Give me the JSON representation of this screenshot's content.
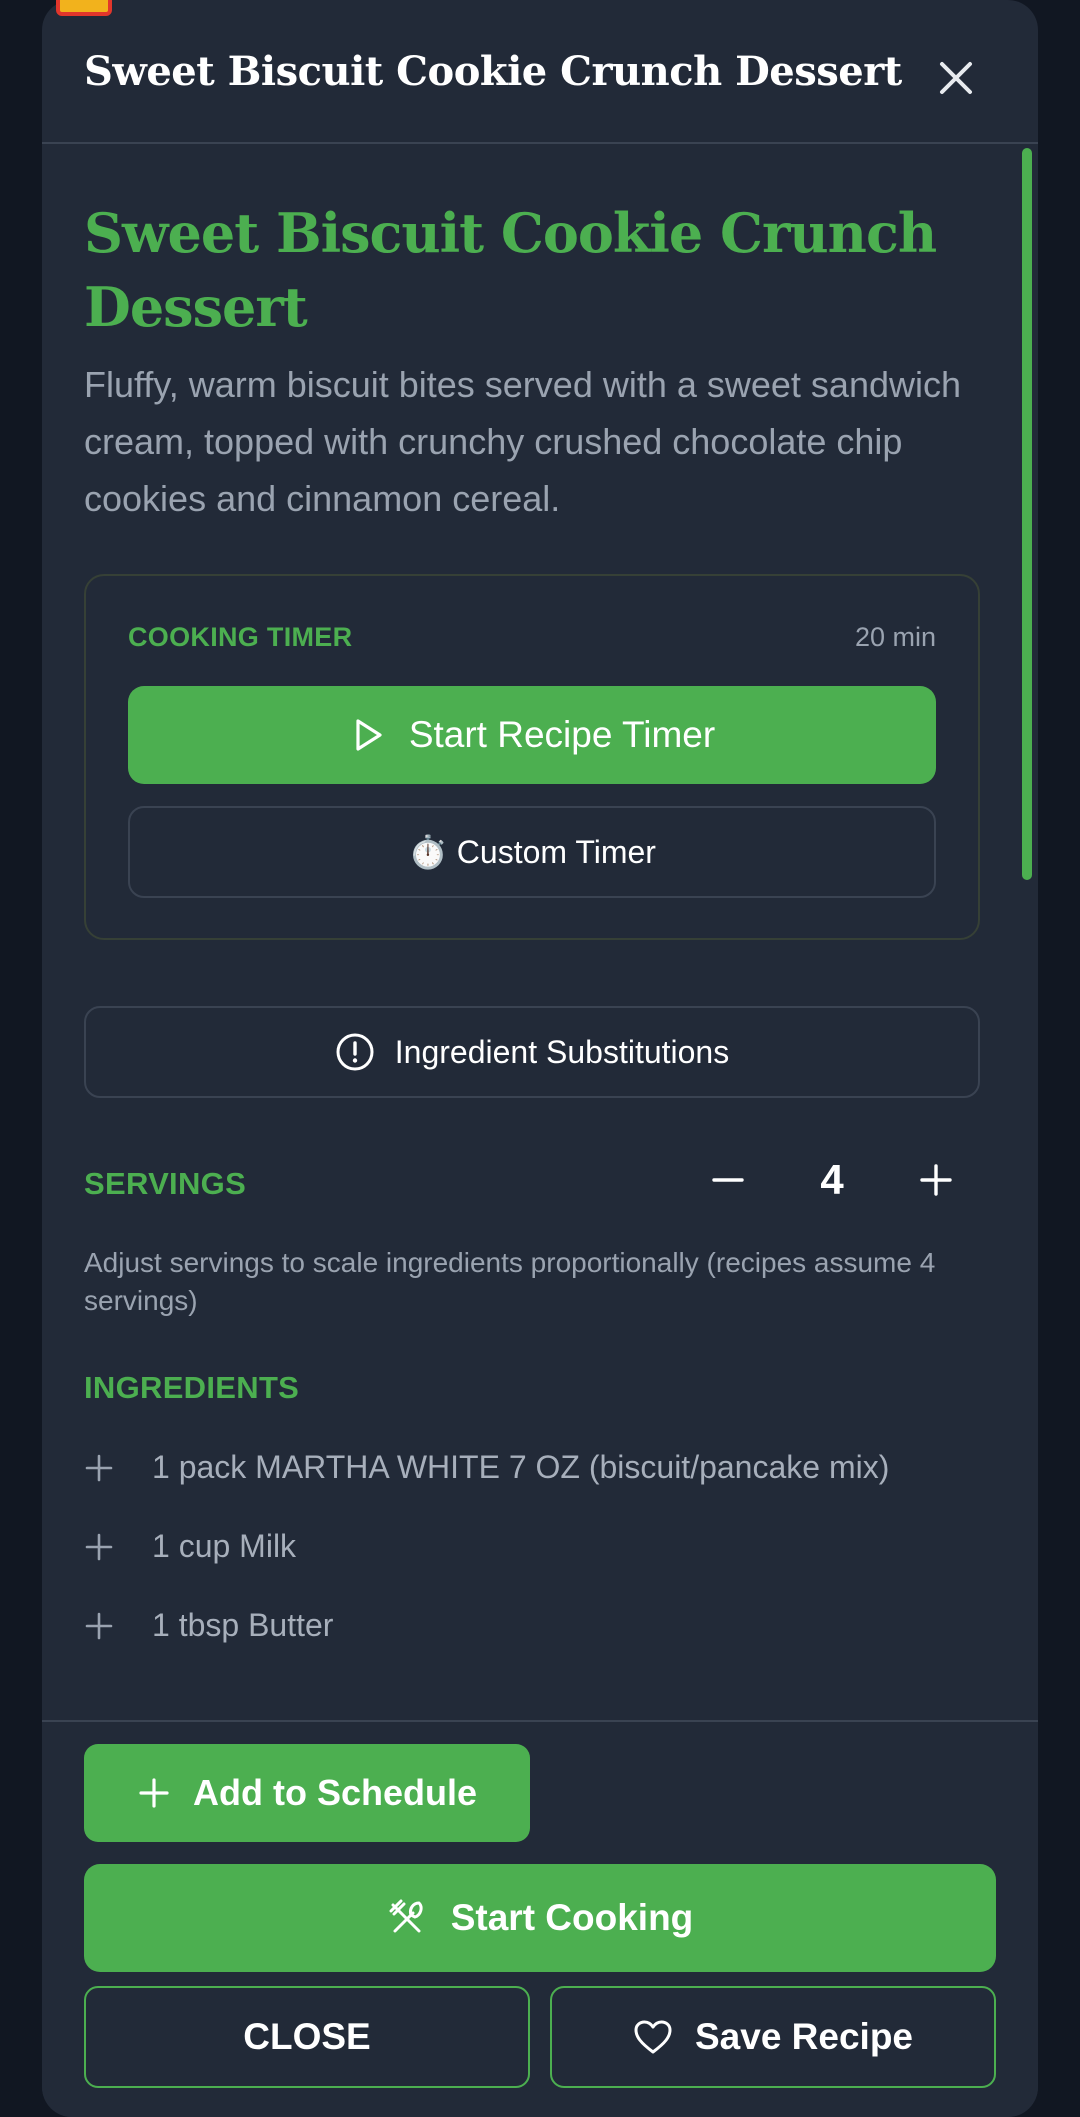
{
  "header": {
    "title": "Sweet Biscuit Cookie Crunch Dessert",
    "close_icon": "close-icon"
  },
  "recipe": {
    "title": "Sweet Biscuit Cookie Crunch Dessert",
    "description": "Fluffy, warm biscuit bites served with a sweet sandwich cream, topped with crunchy crushed chocolate chip cookies and cinnamon cereal."
  },
  "timer": {
    "label": "COOKING TIMER",
    "duration": "20 min",
    "start_label": "Start Recipe Timer",
    "custom_label": "⏱️ Custom Timer"
  },
  "substitutions": {
    "label": "Ingredient Substitutions"
  },
  "servings": {
    "label": "SERVINGS",
    "value": "4",
    "note": "Adjust servings to scale ingredients proportionally (recipes assume 4 servings)"
  },
  "ingredients": {
    "label": "INGREDIENTS",
    "items": [
      "1 pack MARTHA WHITE 7 OZ (biscuit/pancake mix)",
      "1 cup Milk",
      "1 tbsp Butter"
    ]
  },
  "footer": {
    "schedule_label": "Add to Schedule",
    "cook_label": "Start Cooking",
    "close_label": "CLOSE",
    "save_label": "Save Recipe"
  },
  "colors": {
    "accent": "#4caf50",
    "background": "#222a38",
    "page": "#111722"
  }
}
